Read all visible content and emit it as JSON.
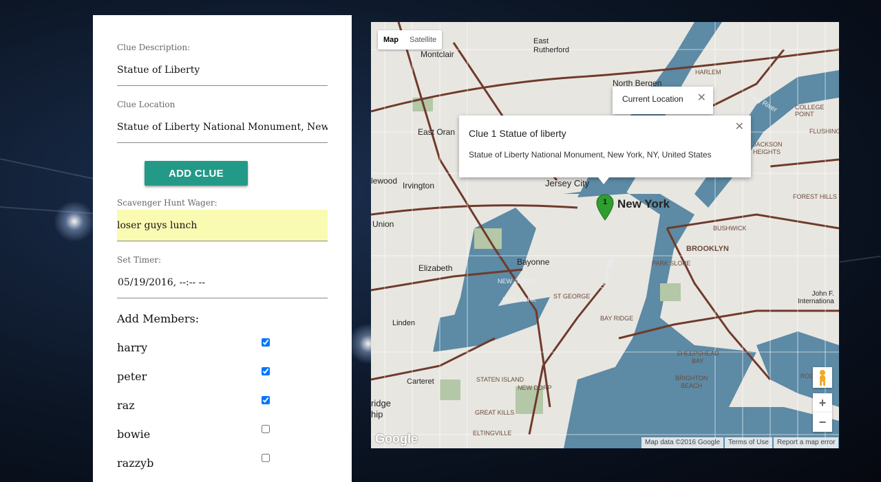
{
  "form": {
    "clue_description_label": "Clue Description:",
    "clue_description_value": "Statue of Liberty",
    "clue_location_label": "Clue Location",
    "clue_location_value": "Statue of Liberty National Monument, New York, NY, United States",
    "add_clue_label": "ADD CLUE",
    "wager_label": "Scavenger Hunt Wager:",
    "wager_value": "loser guys lunch",
    "timer_label": "Set Timer:",
    "timer_value": "05/19/2016, --:-- --",
    "members_title": "Add Members:",
    "members": [
      {
        "name": "harry",
        "checked": true
      },
      {
        "name": "peter",
        "checked": true
      },
      {
        "name": "raz",
        "checked": true
      },
      {
        "name": "bowie",
        "checked": false
      },
      {
        "name": "razzyb",
        "checked": false
      }
    ]
  },
  "map": {
    "type_buttons": [
      "Map",
      "Satellite"
    ],
    "active_type": "Map",
    "current_location_popup": "Current Location",
    "clue_popup_title": "Clue 1 Statue of liberty",
    "clue_popup_address": "Statue of Liberty National Monument, New York, NY, United States",
    "marker_label": "1",
    "zoom_in": "+",
    "zoom_out": "−",
    "logo": "Google",
    "attribution": "Map data ©2016 Google",
    "terms": "Terms of Use",
    "report": "Report a map error",
    "labels": {
      "new_york": "New York",
      "jersey_city": "Jersey City",
      "brooklyn": "BROOKLYN",
      "bayonne": "Bayonne",
      "elizabeth": "Elizabeth",
      "linden": "Linden",
      "carteret": "Carteret",
      "irvington": "Irvington",
      "union": "Union",
      "montclair": "Montclair",
      "east_orange": "East Oran",
      "north_bergen": "North Bergen",
      "east_rutherford": "East\nRutherford",
      "harlem": "HARLEM",
      "upper_bay": "Upper Bay",
      "staten_island": "STATEN ISLAND",
      "new_dorp": "NEW DORP",
      "great_kills": "GREAT KILLS",
      "eltingville": "ELTINGVILLE",
      "st_george": "ST GEORGE",
      "bay_ridge": "BAY RIDGE",
      "park_slope": "PARK SLOPE",
      "bushwick": "BUSHWICK",
      "sheepshead_bay": "SHEEPSHEAD\nBAY",
      "brighton_beach": "BRIGHTON\nBEACH",
      "forest_hills": "FOREST HILLS",
      "jackson_heights": "JACKSON\nHEIGHTS",
      "flushing": "FLUSHING",
      "college_point": "COLLEGE POINT",
      "east_river": "East River",
      "new_jersey": "NEW JERSEY",
      "new_york_state": "NEW YORK",
      "linewood": "lewood",
      "bridge": "ridge",
      "ship": "hip",
      "rockaway": "ROCK",
      "jfk": "John F.\nInternationa"
    },
    "colors": {
      "water": "#5d8aa5",
      "land": "#e8e6e1",
      "highway": "#6f3a2b",
      "park": "#b4c7a7",
      "marker": "#2f9e2f"
    }
  }
}
